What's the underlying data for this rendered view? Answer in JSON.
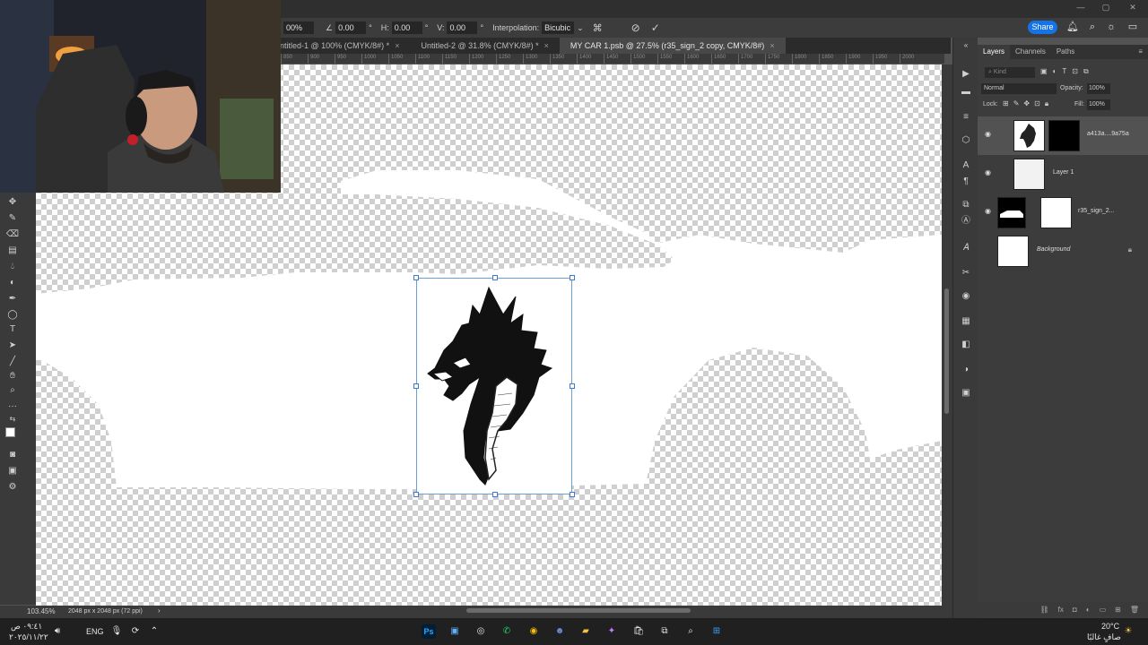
{
  "options_bar": {
    "zoom_partial": "00%",
    "angle_value": "0.00",
    "h_label": "H:",
    "h_value": "0.00",
    "v_label": "V:",
    "v_value": "0.00",
    "interpolation_label": "Interpolation:",
    "interpolation_value": "Bicubic",
    "share_label": "Share"
  },
  "tabs": [
    {
      "label": "ntitled-1 @ 100% (CMYK/8#) *",
      "active": false
    },
    {
      "label": "Untitled-2 @ 31.8% (CMYK/8#) *",
      "active": false
    },
    {
      "label": "MY CAR 1.psb @ 27.5% (r35_sign_2 copy, CMYK/8#)",
      "active": true
    }
  ],
  "ruler_ticks": [
    "850",
    "900",
    "950",
    "1000",
    "1050",
    "1100",
    "1150",
    "1200",
    "1250",
    "1300",
    "1350",
    "1400",
    "1450",
    "1500",
    "1550",
    "1600",
    "1650",
    "1700",
    "1750",
    "1800",
    "1850",
    "1900",
    "1950",
    "2000"
  ],
  "status": {
    "zoom": "103.45%",
    "doc_size": "2048 px x 2048 px (72 ppi)"
  },
  "layers_panel": {
    "tabs": [
      "Layers",
      "Channels",
      "Paths"
    ],
    "search_placeholder": "Kind",
    "blend_mode": "Normal",
    "opacity_label": "Opacity:",
    "opacity_value": "100%",
    "lock_label": "Lock:",
    "fill_label": "Fill:",
    "fill_value": "100%",
    "layers": [
      {
        "name": "a413a....9a75a",
        "visible": true,
        "selected": true
      },
      {
        "name": "Layer 1",
        "visible": true,
        "selected": false
      },
      {
        "name": "r35_sign_2...",
        "visible": true,
        "selected": false
      },
      {
        "name": "Background",
        "visible": false,
        "selected": false
      }
    ]
  },
  "taskbar": {
    "time": "٠٩:٤١ ص",
    "date": "٢٠٢٥/١١/٢٢",
    "language": "ENG",
    "temperature": "20°C",
    "weather": "صافٍ غالبًا"
  }
}
